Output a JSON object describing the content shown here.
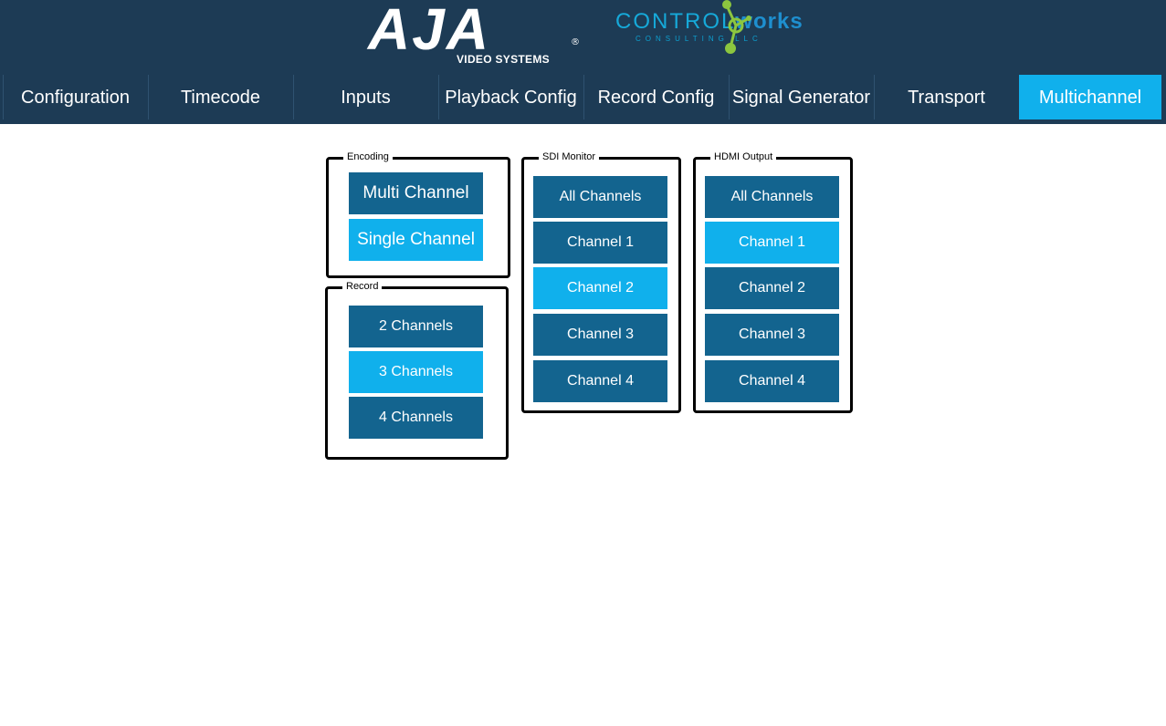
{
  "branding": {
    "aja_word": "AJA",
    "aja_registered": "®",
    "aja_subtitle": "VIDEO SYSTEMS",
    "partner_control": "CONTROL",
    "partner_works": "works",
    "partner_sub": "CONSULTING LLC"
  },
  "tabs": [
    {
      "label": "Configuration",
      "active": false
    },
    {
      "label": "Timecode",
      "active": false
    },
    {
      "label": "Inputs",
      "active": false
    },
    {
      "label": "Playback Config",
      "active": false
    },
    {
      "label": "Record Config",
      "active": false
    },
    {
      "label": "Signal Generator",
      "active": false
    },
    {
      "label": "Transport",
      "active": false
    },
    {
      "label": "Multichannel",
      "active": true
    }
  ],
  "encoding": {
    "title": "Encoding",
    "options": [
      {
        "label": "Multi Channel",
        "selected": false
      },
      {
        "label": "Single Channel",
        "selected": true
      }
    ]
  },
  "record": {
    "title": "Record",
    "options": [
      {
        "label": "2 Channels",
        "selected": false
      },
      {
        "label": "3 Channels",
        "selected": true
      },
      {
        "label": "4 Channels",
        "selected": false
      }
    ]
  },
  "sdi_monitor": {
    "title": "SDI Monitor",
    "options": [
      {
        "label": "All Channels",
        "selected": false
      },
      {
        "label": "Channel 1",
        "selected": false
      },
      {
        "label": "Channel 2",
        "selected": true
      },
      {
        "label": "Channel 3",
        "selected": false
      },
      {
        "label": "Channel 4",
        "selected": false
      }
    ]
  },
  "hdmi_output": {
    "title": "HDMI Output",
    "options": [
      {
        "label": "All Channels",
        "selected": false
      },
      {
        "label": "Channel 1",
        "selected": true
      },
      {
        "label": "Channel 2",
        "selected": false
      },
      {
        "label": "Channel 3",
        "selected": false
      },
      {
        "label": "Channel 4",
        "selected": false
      }
    ]
  },
  "colors": {
    "header_bg": "#1d3b55",
    "active": "#10b0ec",
    "inactive_button": "#13648f"
  }
}
